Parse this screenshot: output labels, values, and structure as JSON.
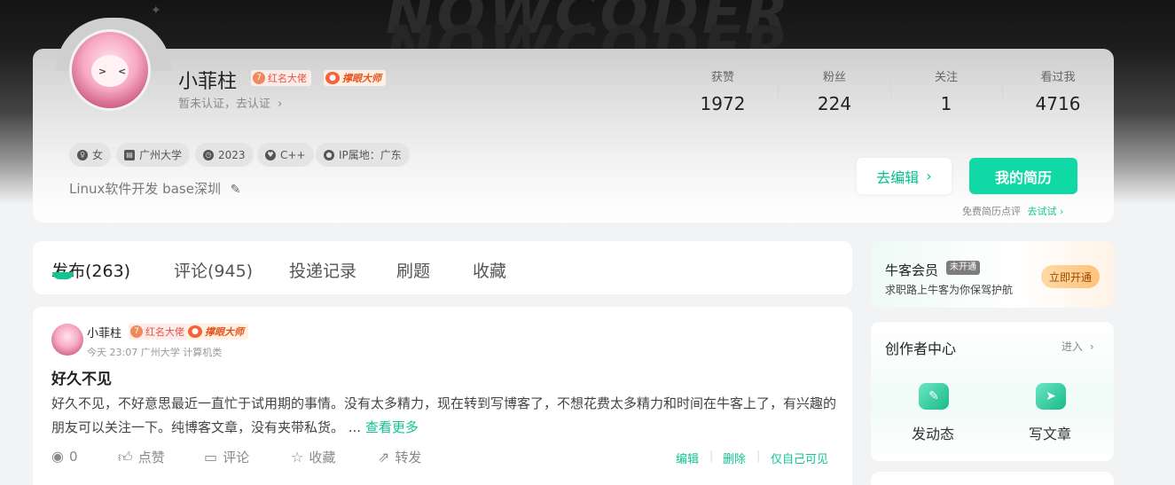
{
  "banner": {
    "word1": "NOWCODER",
    "word2": "NOWCODER"
  },
  "profile": {
    "username": "小菲柱",
    "badge_level": "7",
    "badge_red": "红名大佬",
    "badge_orange": "撑眼大师",
    "verify_text": "暂未认证，去认证",
    "stats": [
      {
        "label": "获赞",
        "value": "1972"
      },
      {
        "label": "粉丝",
        "value": "224"
      },
      {
        "label": "关注",
        "value": "1"
      },
      {
        "label": "看过我",
        "value": "4716"
      }
    ],
    "tags": [
      "女",
      "广州大学",
      "2023",
      "C++",
      "IP属地：广东"
    ],
    "bio": "Linux软件开发 base深圳",
    "edit_label": "去编辑",
    "resume_label": "我的简历",
    "resume_hint": "免费简历点评",
    "resume_try": "去试试"
  },
  "tabs": [
    "发布(263)",
    "评论(945)",
    "投递记录",
    "刷题",
    "收藏"
  ],
  "post": {
    "author": "小菲柱",
    "badge_level": "7",
    "badge_red": "红名大佬",
    "badge_orange": "撑眼大师",
    "meta": "今天 23:07  广州大学 计算机类",
    "title": "好久不见",
    "body": "好久不见，不好意思最近一直忙于试用期的事情。没有太多精力，现在转到写博客了，不想花费太多精力和时间在牛客上了，有兴趣的朋友可以关注一下。纯博客文章，没有夹带私货。 ... ",
    "more": "查看更多",
    "views": "0",
    "like": "点赞",
    "comment": "评论",
    "collect": "收藏",
    "share": "转发",
    "edit": "编辑",
    "delete": "删除",
    "visibility": "仅自己可见"
  },
  "vip": {
    "title": "牛客会员",
    "tag": "未开通",
    "subtitle": "求职路上牛客为你保驾护航",
    "button": "立即开通"
  },
  "creator": {
    "title": "创作者中心",
    "enter": "进入",
    "post_label": "发动态",
    "article_label": "写文章"
  }
}
